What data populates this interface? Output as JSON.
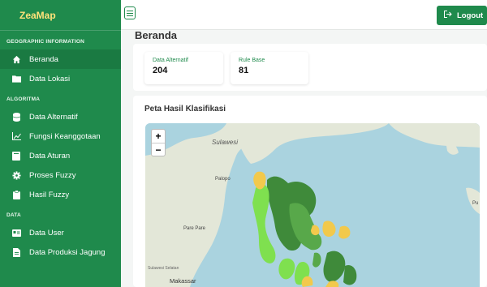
{
  "brand": "ZeaMap",
  "sidebar": {
    "sections": [
      {
        "title": "GEOGRAPHIC INFORMATION",
        "items": [
          {
            "label": "Beranda",
            "icon": "home-icon",
            "active": true
          },
          {
            "label": "Data Lokasi",
            "icon": "folder-icon"
          }
        ]
      },
      {
        "title": "ALGORITMA",
        "items": [
          {
            "label": "Data Alternatif",
            "icon": "database-icon"
          },
          {
            "label": "Fungsi Keanggotaan",
            "icon": "chart-line-icon"
          },
          {
            "label": "Data Aturan",
            "icon": "book-icon"
          },
          {
            "label": "Proses Fuzzy",
            "icon": "gear-icon"
          },
          {
            "label": "Hasil Fuzzy",
            "icon": "clipboard-icon"
          }
        ]
      },
      {
        "title": "DATA",
        "items": [
          {
            "label": "Data User",
            "icon": "id-card-icon"
          },
          {
            "label": "Data Produksi Jagung",
            "icon": "document-icon"
          }
        ]
      }
    ]
  },
  "topbar": {
    "logout_label": "Logout"
  },
  "page": {
    "title": "Beranda"
  },
  "stats": [
    {
      "label": "Data Alternatif",
      "value": "204"
    },
    {
      "label": "Rule Base",
      "value": "81"
    }
  ],
  "map": {
    "title": "Peta Hasil Klasifikasi",
    "zoom_in": "+",
    "zoom_out": "−",
    "labels": [
      "Sulawesi",
      "Palopo",
      "Pare Pare",
      "Makassar",
      "Sulawesi Selatan",
      "Pu"
    ],
    "colors": {
      "sea": "#aad3df",
      "land": "#e3e7d8",
      "dark_green": "#3f8a3a",
      "green": "#58a84a",
      "light_green": "#7fe04f",
      "yellow": "#f2c94c"
    }
  },
  "colors": {
    "accent": "#1f8a4c",
    "brand_text": "#ffe27a"
  }
}
